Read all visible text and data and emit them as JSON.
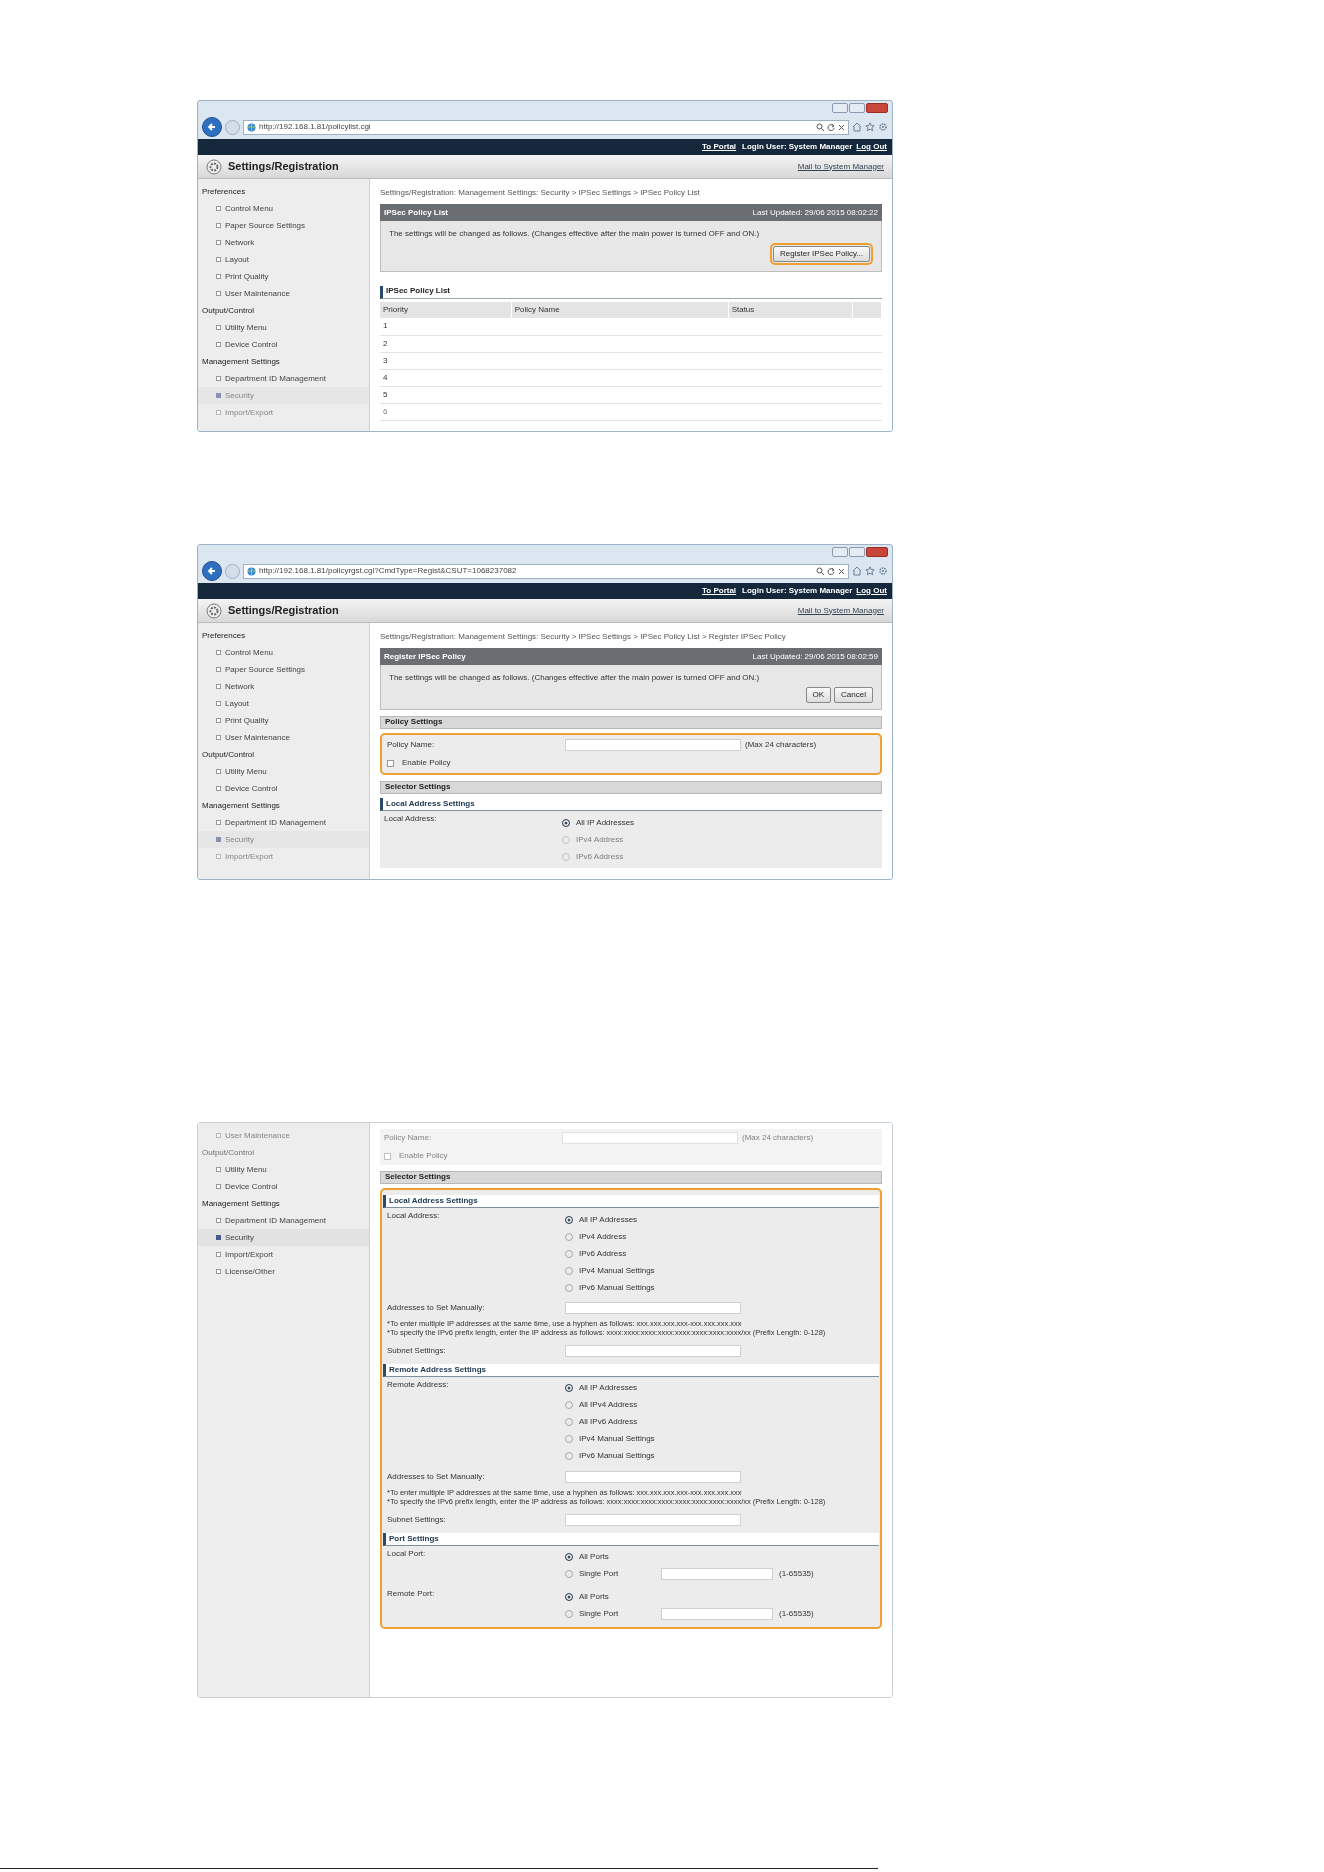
{
  "screenshots": [
    {
      "kind": "browser",
      "url": "http://192.168.1.81/policylist.cgi",
      "top_bar": {
        "to_portal": "To Portal",
        "login_user": "Login User: System Manager",
        "log_out": "Log Out"
      },
      "app_title": "Settings/Registration",
      "mail_link": "Mail to System Manager",
      "sidebar": [
        {
          "kind": "heading",
          "label": "Preferences",
          "faded": false
        },
        {
          "kind": "item",
          "label": "Control Menu",
          "selected": false,
          "faded": false
        },
        {
          "kind": "item",
          "label": "Paper Source Settings",
          "selected": false,
          "faded": false
        },
        {
          "kind": "item",
          "label": "Network",
          "selected": false,
          "faded": false
        },
        {
          "kind": "item",
          "label": "Layout",
          "selected": false,
          "faded": false
        },
        {
          "kind": "item",
          "label": "Print Quality",
          "selected": false,
          "faded": false
        },
        {
          "kind": "item",
          "label": "User Maintenance",
          "selected": false,
          "faded": false
        },
        {
          "kind": "heading",
          "label": "Output/Control",
          "faded": false
        },
        {
          "kind": "item",
          "label": "Utility Menu",
          "selected": false,
          "faded": false
        },
        {
          "kind": "item",
          "label": "Device Control",
          "selected": false,
          "faded": false
        },
        {
          "kind": "heading",
          "label": "Management Settings",
          "faded": false
        },
        {
          "kind": "item",
          "label": "Department ID Management",
          "selected": false,
          "faded": false
        },
        {
          "kind": "item",
          "label": "Security",
          "selected": true,
          "faded": true
        },
        {
          "kind": "item",
          "label": "Import/Export",
          "selected": false,
          "faded": true
        }
      ],
      "breadcrumb": "Settings/Registration: Management Settings: Security > IPSec Settings > IPSec Policy List",
      "panel": {
        "title": "IPSec Policy List",
        "last_updated": "Last Updated: 29/06 2015 08:02:22",
        "message": "The settings will be changed as follows. (Changes effective after the main power is turned OFF and ON.)",
        "buttons": [
          {
            "label": "Register IPSec Policy...",
            "highlighted": true
          }
        ]
      },
      "sections": [
        {
          "kind": "table",
          "title": "IPSec Policy List",
          "columns": [
            "Priority",
            "Policy Name",
            "Status"
          ],
          "rows": [
            {
              "label": "1",
              "faded": false
            },
            {
              "label": "2",
              "faded": false
            },
            {
              "label": "3",
              "faded": false
            },
            {
              "label": "4",
              "faded": false
            },
            {
              "label": "5",
              "faded": false
            },
            {
              "label": "6",
              "faded": true
            }
          ]
        }
      ]
    },
    {
      "kind": "browser",
      "url": "http://192.168.1.81/policyrgst.cgi?CmdType=Regist&CSUT=1068237082",
      "top_bar": {
        "to_portal": "To Portal",
        "login_user": "Login User: System Manager",
        "log_out": "Log Out"
      },
      "app_title": "Settings/Registration",
      "mail_link": "Mail to System Manager",
      "sidebar": [
        {
          "kind": "heading",
          "label": "Preferences",
          "faded": false
        },
        {
          "kind": "item",
          "label": "Control Menu",
          "selected": false,
          "faded": false
        },
        {
          "kind": "item",
          "label": "Paper Source Settings",
          "selected": false,
          "faded": false
        },
        {
          "kind": "item",
          "label": "Network",
          "selected": false,
          "faded": false
        },
        {
          "kind": "item",
          "label": "Layout",
          "selected": false,
          "faded": false
        },
        {
          "kind": "item",
          "label": "Print Quality",
          "selected": false,
          "faded": false
        },
        {
          "kind": "item",
          "label": "User Maintenance",
          "selected": false,
          "faded": false
        },
        {
          "kind": "heading",
          "label": "Output/Control",
          "faded": false
        },
        {
          "kind": "item",
          "label": "Utility Menu",
          "selected": false,
          "faded": false
        },
        {
          "kind": "item",
          "label": "Device Control",
          "selected": false,
          "faded": false
        },
        {
          "kind": "heading",
          "label": "Management Settings",
          "faded": false
        },
        {
          "kind": "item",
          "label": "Department ID Management",
          "selected": false,
          "faded": false
        },
        {
          "kind": "item",
          "label": "Security",
          "selected": true,
          "faded": true
        },
        {
          "kind": "item",
          "label": "Import/Export",
          "selected": false,
          "faded": true
        }
      ],
      "breadcrumb": "Settings/Registration: Management Settings: Security > IPSec Settings > IPSec Policy List > Register IPSec Policy",
      "panel": {
        "title": "Register IPSec Policy",
        "last_updated": "Last Updated: 29/06 2015 08:02:59",
        "message": "The settings will be changed as follows. (Changes effective after the main power is turned OFF and ON.)",
        "buttons": [
          {
            "label": "OK",
            "highlighted": false
          },
          {
            "label": "Cancel",
            "highlighted": false
          }
        ]
      },
      "sections": [
        {
          "kind": "bar",
          "title": "Policy Settings",
          "faded": false
        },
        {
          "kind": "group",
          "highlighted": true,
          "children": [
            {
              "kind": "field",
              "label": "Policy Name:",
              "hint": "(Max 24 characters)",
              "faded": false
            },
            {
              "kind": "checkbox",
              "label": "Enable Policy",
              "checked": false,
              "faded": false
            }
          ]
        },
        {
          "kind": "bar",
          "title": "Selector Settings",
          "faded": false
        },
        {
          "kind": "subheading",
          "title": "Local Address Settings"
        },
        {
          "kind": "radio_group",
          "label": "Local Address:",
          "options": [
            {
              "label": "All IP Addresses",
              "selected": true,
              "faded": false
            },
            {
              "label": "IPv4 Address",
              "selected": false,
              "faded": true
            },
            {
              "label": "IPv6 Address",
              "selected": false,
              "faded": true
            }
          ]
        }
      ]
    },
    {
      "kind": "content",
      "sidebar": [
        {
          "kind": "item",
          "label": "User Maintenance",
          "selected": false,
          "faded": true
        },
        {
          "kind": "heading",
          "label": "Output/Control",
          "faded": true
        },
        {
          "kind": "item",
          "label": "Utility Menu",
          "selected": false,
          "faded": false
        },
        {
          "kind": "item",
          "label": "Device Control",
          "selected": false,
          "faded": false
        },
        {
          "kind": "heading",
          "label": "Management Settings",
          "faded": false
        },
        {
          "kind": "item",
          "label": "Department ID Management",
          "selected": false,
          "faded": false
        },
        {
          "kind": "item",
          "label": "Security",
          "selected": true,
          "faded": false
        },
        {
          "kind": "item",
          "label": "Import/Export",
          "selected": false,
          "faded": false
        },
        {
          "kind": "item",
          "label": "License/Other",
          "selected": false,
          "faded": false
        }
      ],
      "sections": [
        {
          "kind": "field",
          "label": "Policy Name:",
          "hint": "(Max 24 characters)",
          "faded": true
        },
        {
          "kind": "checkbox",
          "label": "Enable Policy",
          "checked": false,
          "faded": true
        },
        {
          "kind": "bar",
          "title": "Selector Settings",
          "faded": false
        },
        {
          "kind": "group",
          "highlighted": true,
          "children": [
            {
              "kind": "subheading",
              "title": "Local Address Settings"
            },
            {
              "kind": "radio_group",
              "label": "Local Address:",
              "options": [
                {
                  "label": "All IP Addresses",
                  "selected": true,
                  "faded": false
                },
                {
                  "label": "IPv4 Address",
                  "selected": false,
                  "faded": false
                },
                {
                  "label": "IPv6 Address",
                  "selected": false,
                  "faded": false
                },
                {
                  "label": "IPv4 Manual Settings",
                  "selected": false,
                  "faded": false
                },
                {
                  "label": "IPv6 Manual Settings",
                  "selected": false,
                  "faded": false
                }
              ]
            },
            {
              "kind": "field",
              "label": "Addresses to Set Manually:",
              "faded": false
            },
            {
              "kind": "note",
              "lines": [
                "*To enter multiple IP addresses at the same time, use a hyphen as follows: xxx.xxx.xxx.xxx-xxx.xxx.xxx.xxx",
                "*To specify the IPv6 prefix length, enter the IP address as follows: xxxx:xxxx:xxxx:xxxx:xxxx:xxxx:xxxx:xxxx/xx (Prefix Length: 0-128)"
              ]
            },
            {
              "kind": "field",
              "label": "Subnet Settings:",
              "faded": false
            },
            {
              "kind": "subheading",
              "title": "Remote Address Settings"
            },
            {
              "kind": "radio_group",
              "label": "Remote Address:",
              "options": [
                {
                  "label": "All IP Addresses",
                  "selected": true,
                  "faded": false
                },
                {
                  "label": "All IPv4 Address",
                  "selected": false,
                  "faded": false
                },
                {
                  "label": "All IPv6 Address",
                  "selected": false,
                  "faded": false
                },
                {
                  "label": "IPv4 Manual Settings",
                  "selected": false,
                  "faded": false
                },
                {
                  "label": "IPv6 Manual Settings",
                  "selected": false,
                  "faded": false
                }
              ]
            },
            {
              "kind": "field",
              "label": "Addresses to Set Manually:",
              "faded": false
            },
            {
              "kind": "note",
              "lines": [
                "*To enter multiple IP addresses at the same time, use a hyphen as follows: xxx.xxx.xxx.xxx-xxx.xxx.xxx.xxx",
                "*To specify the IPv6 prefix length, enter the IP address as follows: xxxx:xxxx:xxxx:xxxx:xxxx:xxxx:xxxx:xxxx/xx (Prefix Length: 0-128)"
              ]
            },
            {
              "kind": "field",
              "label": "Subnet Settings:",
              "faded": false
            },
            {
              "kind": "subheading",
              "title": "Port Settings"
            },
            {
              "kind": "radio_group",
              "label": "Local Port:",
              "options": [
                {
                  "label": "All Ports",
                  "selected": true,
                  "faded": false
                },
                {
                  "label": "Single Port",
                  "selected": false,
                  "faded": false,
                  "hint": "(1-65535)"
                }
              ]
            },
            {
              "kind": "radio_group",
              "label": "Remote Port:",
              "options": [
                {
                  "label": "All Ports",
                  "selected": true,
                  "faded": false
                },
                {
                  "label": "Single Port",
                  "selected": false,
                  "faded": false,
                  "hint": "(1-65535)"
                }
              ]
            }
          ]
        }
      ]
    }
  ]
}
